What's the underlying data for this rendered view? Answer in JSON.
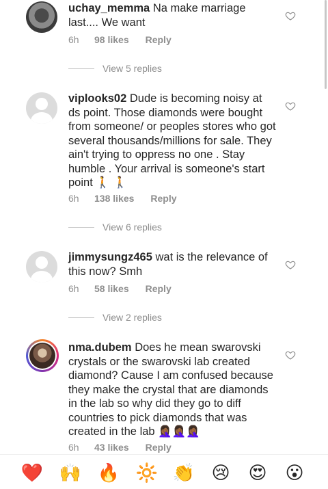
{
  "comments": [
    {
      "username": "uchay_memma",
      "text": " Na make marriage last.... We want",
      "time": "6h",
      "likes": "98 likes",
      "reply_label": "Reply",
      "view_replies": "View 5 replies"
    },
    {
      "username": "viplooks02",
      "text": " Dude is becoming noisy at ds point. Those diamonds were bought from someone/ or peoples stores who got several thousands/millions for sale. They ain't trying to oppress no one . Stay humble . Your arrival is someone's start point 🚶 🚶",
      "time": "6h",
      "likes": "138 likes",
      "reply_label": "Reply",
      "view_replies": "View 6 replies"
    },
    {
      "username": "jimmysungz465",
      "text": " wat is the relevance of this now? Smh",
      "time": "6h",
      "likes": "58 likes",
      "reply_label": "Reply",
      "view_replies": "View 2 replies"
    },
    {
      "username": "nma.dubem",
      "text": " Does he mean swarovski crystals or the swarovski lab created diamond? Cause I am confused because they make the crystal that are diamonds in the lab so why did they go to diff countries to pick diamonds that was created in the lab 🤦🏾‍♀️🤦🏾‍♀️🤦🏾‍♀️",
      "time": "6h",
      "likes": "43 likes",
      "reply_label": "Reply"
    }
  ],
  "emoji_bar": [
    "❤️",
    "🙌",
    "🔥",
    "🔆",
    "👏",
    "😢",
    "😍",
    "😮"
  ],
  "colors": {
    "text": "#262626",
    "meta": "#8e8e8e",
    "heart_outline": "#8e8e8e"
  }
}
